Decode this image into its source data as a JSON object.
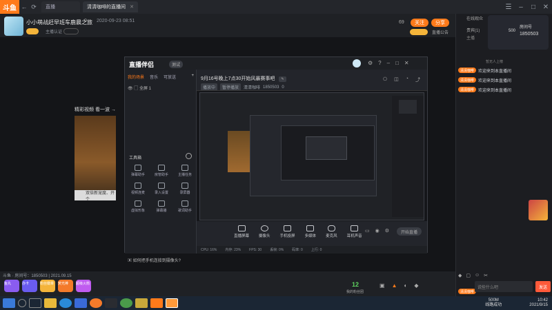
{
  "browser": {
    "search_text": "直播",
    "active_tab": "清清咖啡的直播间",
    "logo": "斗鱼"
  },
  "room": {
    "title": "小小萌战赶早班车鹿晨之旅",
    "likes": "0",
    "date": "2020-09-23 08:51",
    "tag1": "主播认证",
    "rank": "69",
    "follow": "关注",
    "share": "分享",
    "report": "直播公告",
    "room_info": "斗鱼 · 房间号：1850503 | 2021.09.15"
  },
  "software": {
    "app_name": "直播伴侣",
    "version": "测试",
    "tabs": [
      "我的场景",
      "音乐",
      "可放送"
    ],
    "scene_item": "全屏 1",
    "tools_title": "工具箱",
    "tools": [
      "弹幕助手",
      "房管助手",
      "主播任务",
      "视频连麦",
      "录入设置",
      "录屏器",
      "虚拟形象",
      "弹幕播",
      "歌词助手"
    ],
    "stream_title": "9月16号晚上7点30开始风暴赛事吧",
    "stream_sub": [
      "播放中",
      "暂停播放",
      "清清咖啡",
      "1850503",
      "0"
    ],
    "bottom_tools": [
      "直播屏幕",
      "摄像头",
      "手机投屏",
      "多媒体",
      "麦克风",
      "耳机声音"
    ],
    "live_button": "开始直播",
    "status": [
      "CPU: 16%",
      "内存: 23%",
      "FPS: 30",
      "丢帧: 0%",
      "码率: 0",
      "上行: 0"
    ],
    "hint": "如何把手机连接到摄像头?"
  },
  "thumb": {
    "caption": "精彩视频  看一波 →",
    "bottom_text": "双倍新宠度、开个"
  },
  "gifts": {
    "items": [
      "鱼丸",
      "办卡",
      "粉丝徽章",
      "荧光棒",
      "超级火箭"
    ],
    "fan_count": "12",
    "fan_label": "我的粉丝团"
  },
  "right_panel": {
    "streamer_name": "房间号",
    "streamer_id": "1850503",
    "views": "500",
    "tabs": [
      "在线观众",
      "贵宾(1)"
    ],
    "host_label": "主播",
    "messages": [
      {
        "badge": "清清咖啡",
        "text": "欢迎来到本直播间"
      },
      {
        "badge": "清清咖啡",
        "text": "欢迎来到本直播间"
      },
      {
        "badge": "清清咖啡",
        "text": "欢迎来到本直播间"
      },
      {
        "badge": "清清咖啡",
        "text": "欢迎来到本直播间"
      }
    ],
    "system_msg": "暂无人上榜",
    "input_placeholder": "说些什么吧",
    "send": "发送"
  },
  "taskbar": {
    "net": "500M",
    "net_label": "线路成功",
    "time": "10:42",
    "date": "2021/9/15"
  },
  "colors": {
    "accent": "#ff7a1a",
    "bg": "#1b1c20"
  }
}
